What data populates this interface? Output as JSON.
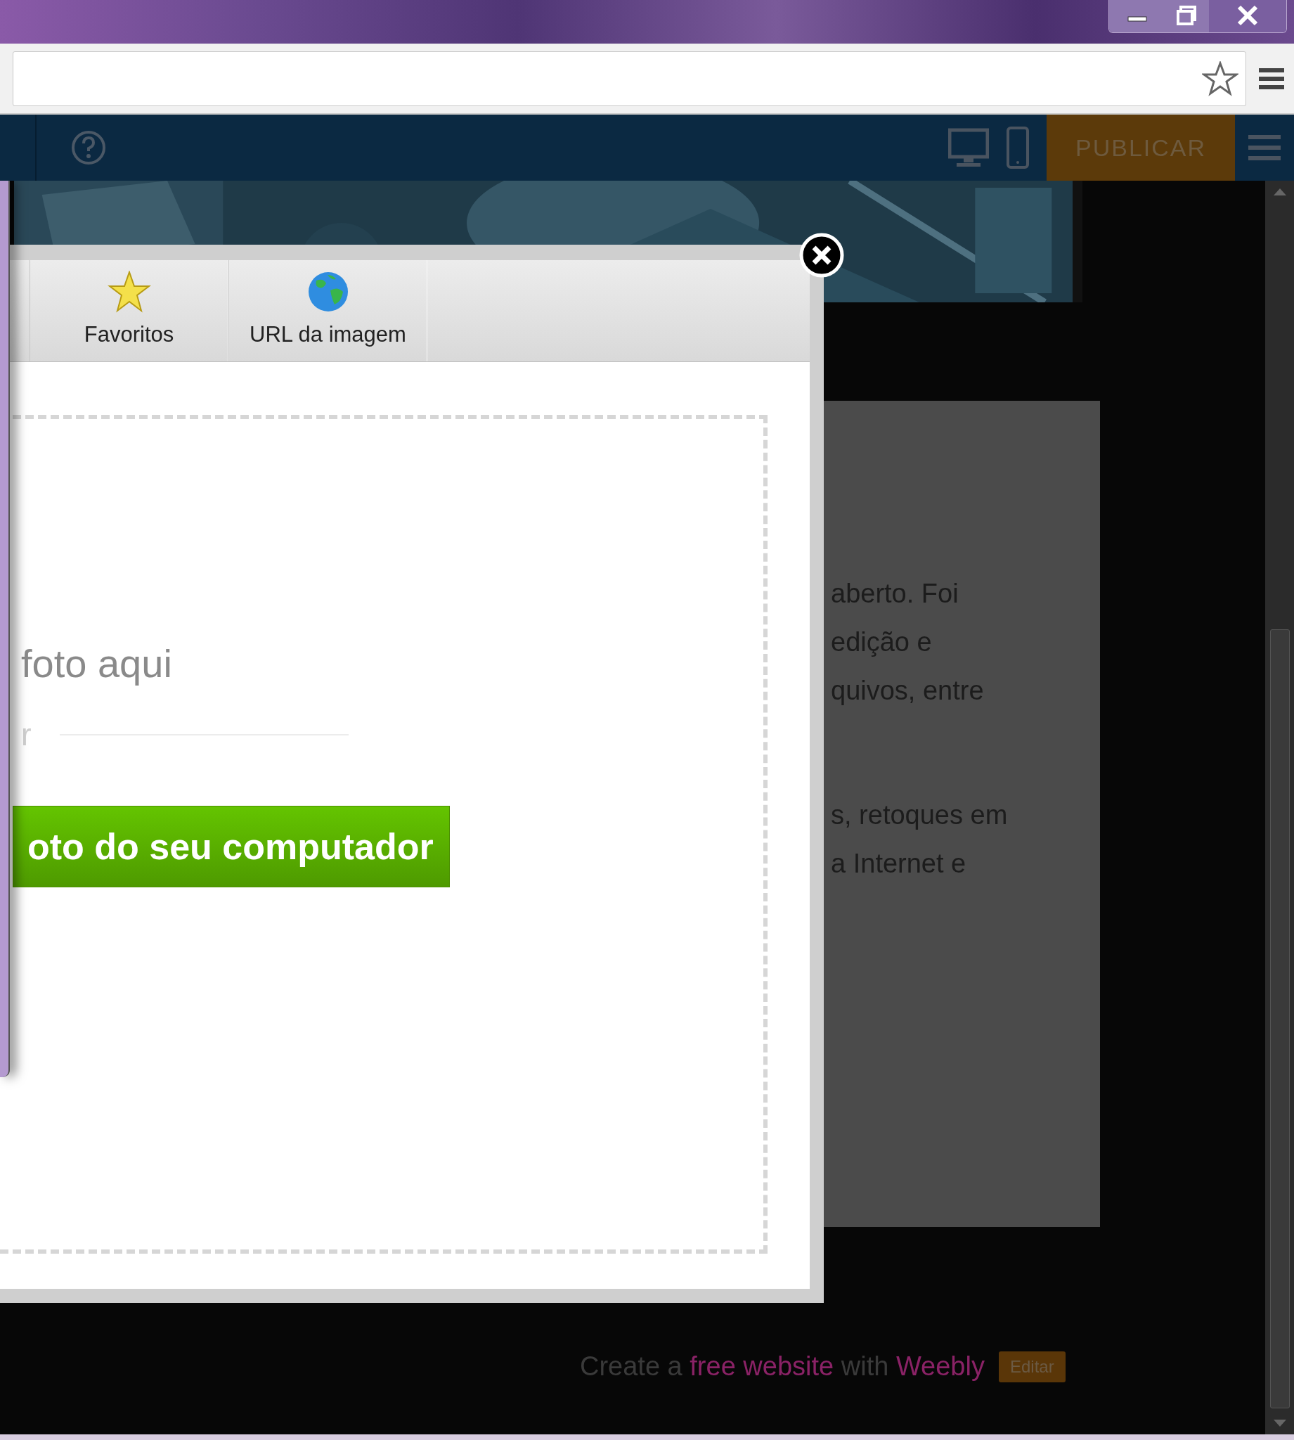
{
  "toolbar": {
    "publish_button": "PUBLICAR"
  },
  "page": {
    "paragraph_lines": [
      "aberto. Foi",
      "edição e",
      "quivos, entre",
      "s, retoques em",
      "a Internet e"
    ],
    "footer": {
      "segments": [
        {
          "text": "Create a",
          "kind": "plain"
        },
        {
          "text": "free website",
          "kind": "link"
        },
        {
          "text": "with",
          "kind": "plain"
        },
        {
          "text": "Weebly",
          "kind": "link"
        }
      ],
      "edit_button": "Editar"
    }
  },
  "dialog": {
    "tabs": [
      {
        "label": "Favoritos",
        "selected": false
      },
      {
        "label": "URL da imagem",
        "selected": false
      }
    ],
    "drop_text": "foto aqui",
    "divider_text": "r",
    "upload_button": "oto do seu computador"
  }
}
